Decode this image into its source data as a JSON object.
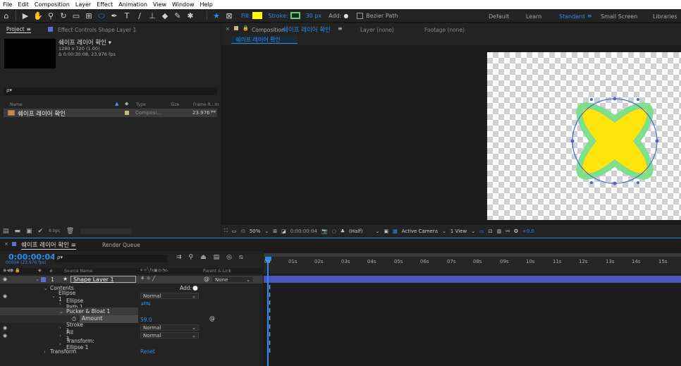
{
  "menu": [
    "File",
    "Edit",
    "Composition",
    "Layer",
    "Effect",
    "Animation",
    "View",
    "Window",
    "Help"
  ],
  "toolbar": {
    "fill_label": "Fill:",
    "stroke_label": "Stroke:",
    "stroke_width": "30 px",
    "add_label": "Add:",
    "bezier_label": "Bezier Path",
    "workspaces": [
      "Default",
      "Learn",
      "Standard",
      "Small Screen",
      "Libraries"
    ],
    "fill_color": "#ffff00",
    "stroke_color": "#5ad17a"
  },
  "project": {
    "tab": "Project",
    "effect_tab": "Effect Controls Shape Layer 1",
    "comp_name": "쉐이프 레이어 확인 ▾",
    "comp_size": "1280 x 720 (1.00)",
    "comp_duration": "Δ 0:00:30:08, 23.976 fps",
    "search_placeholder": "ρ▾",
    "columns": {
      "name": "Name",
      "type": "Type",
      "size": "Size",
      "frame": "Frame R...",
      "in": "In"
    },
    "item": {
      "name": "쉐이프 레이어 확인",
      "type": "Composi...",
      "fps": "23.976"
    },
    "bpc": "8 bpc"
  },
  "composition": {
    "tab_prefix": "Composition",
    "tab_name": "쉐이프 레이어 확인",
    "tab_menu": "≡",
    "sub_tab": "쉐이프 레이어 확인",
    "layer_tab": "Layer (none)",
    "footage_tab": "Footage (none)"
  },
  "viewer": {
    "zoom": "50%",
    "timecode": "0:00:00:04",
    "resolution": "(Half)",
    "camera": "Active Camera",
    "view": "1 View",
    "exposure": "+0.0"
  },
  "timeline": {
    "tab": "쉐이프 레이어 확인",
    "menu": "≡",
    "render_queue": "Render Queue",
    "timecode": "0:00:00:04",
    "frame_info": "00004 (23.976 fps)",
    "search_placeholder": "ρ▾",
    "col_source": "Source Name",
    "col_parent": "Parent & Link",
    "col_num": "#",
    "ticks": [
      "0s",
      "01s",
      "02s",
      "03s",
      "04s",
      "05s",
      "06s",
      "07s",
      "08s",
      "09s",
      "10s",
      "11s",
      "12s",
      "13s",
      "14s",
      "15s"
    ],
    "layer": {
      "num": "1",
      "name": "Shape Layer 1",
      "parent": "None"
    },
    "rows": {
      "contents": "Contents",
      "add": "Add:",
      "ellipse1": "Ellipse 1",
      "ellipse_path": "Ellipse Path 1",
      "pucker": "Pucker & Bloat 1",
      "amount": "Amount",
      "amount_val": "59.0",
      "stroke": "Stroke 1",
      "fill": "Fill 1",
      "transform_ellipse": "Transform: Ellipse 1",
      "transform": "Transform",
      "reset": "Reset",
      "normal": "Normal"
    }
  }
}
